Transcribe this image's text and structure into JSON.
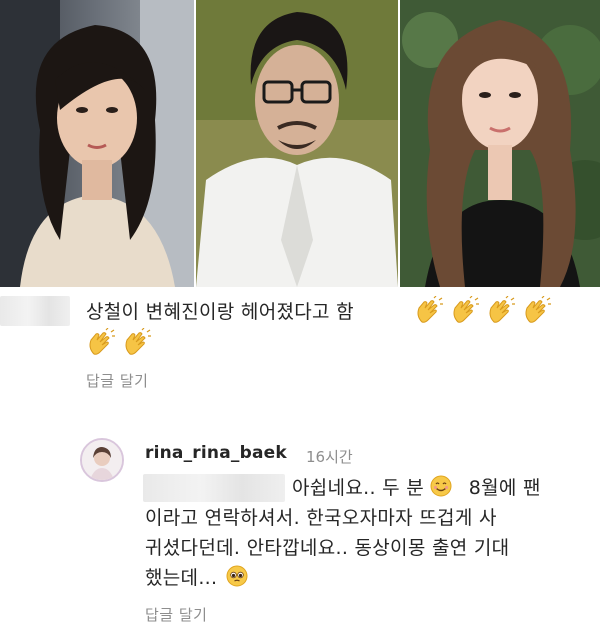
{
  "comment1": {
    "text": "상철이  변혜진이랑 헤어졌다고 함",
    "emoji_icon": "clapping-hands-icon",
    "reply_label": "답글 달기"
  },
  "reply_comment": {
    "username": "rina_rina_baek",
    "time": "16시간",
    "line1_a": "아쉽네요.. 두 분",
    "line1_b": "8월에 팬",
    "line2": "이라고 연락하셔서. 한국오자마자 뜨겁게 사",
    "line3": "귀셨다던데. 안타깝네요.. 동상이몽 출연 기대",
    "line4": "했는데...",
    "emoji1": "smiling-face-icon",
    "emoji2": "pleading-face-icon",
    "reply_label": "답글 달기"
  }
}
